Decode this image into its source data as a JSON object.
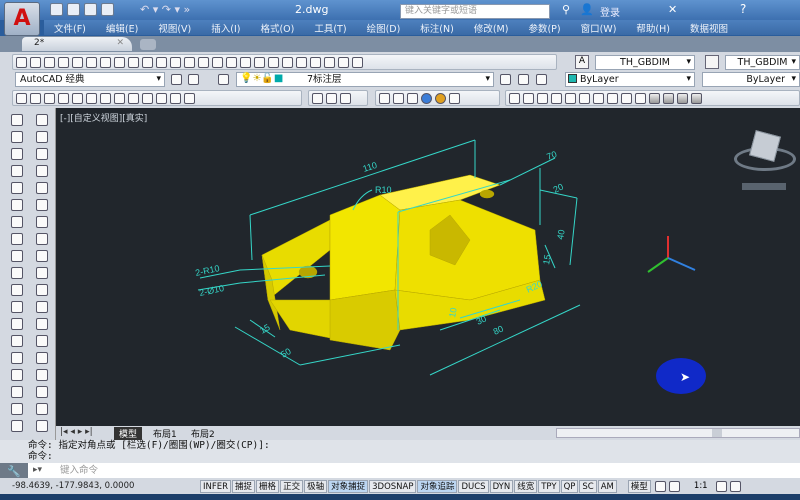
{
  "title": {
    "doc": "2.dwg",
    "search_placeholder": "键入关键字或短语",
    "login": "登录"
  },
  "menu": [
    "文件(F)",
    "编辑(E)",
    "视图(V)",
    "插入(I)",
    "格式(O)",
    "工具(T)",
    "绘图(D)",
    "标注(N)",
    "修改(M)",
    "参数(P)",
    "窗口(W)",
    "帮助(H)",
    "数据视图"
  ],
  "doc_tab": "2*",
  "toolbar": {
    "dimstyle1": "TH_GBDIM",
    "dimstyle2": "TH_GBDIM",
    "workspace": "AutoCAD 经典",
    "layer": "7标注层",
    "color": "ByLayer",
    "linetype": "ByLayer"
  },
  "viewport": {
    "label": "[-][自定义视图][真实]"
  },
  "drawing": {
    "dims": [
      "110",
      "70",
      "R10",
      "20",
      "40",
      "15",
      "R20",
      "10",
      "30",
      "80",
      "15",
      "50",
      "2-R10",
      "2-Ø10"
    ]
  },
  "layout_tabs": [
    "模型",
    "布局1",
    "布局2"
  ],
  "command": {
    "line1": "命令: 指定对角点或 [栏选(F)/圈围(WP)/圈交(CP)]:",
    "line2": "命令:",
    "placeholder": "键入命令"
  },
  "status": {
    "coords": "-98.4639,  -177.9843, 0.0000",
    "toggles": [
      {
        "label": "INFER",
        "on": false
      },
      {
        "label": "捕捉",
        "on": false
      },
      {
        "label": "栅格",
        "on": false
      },
      {
        "label": "正交",
        "on": false
      },
      {
        "label": "极轴",
        "on": false
      },
      {
        "label": "对象捕捉",
        "on": true
      },
      {
        "label": "3DOSNAP",
        "on": false
      },
      {
        "label": "对象追踪",
        "on": true
      },
      {
        "label": "DUCS",
        "on": false
      },
      {
        "label": "DYN",
        "on": false
      },
      {
        "label": "线宽",
        "on": false
      },
      {
        "label": "TPY",
        "on": false
      },
      {
        "label": "QP",
        "on": false
      },
      {
        "label": "SC",
        "on": false
      },
      {
        "label": "AM",
        "on": false
      }
    ],
    "model": "模型",
    "scale": "1:1"
  },
  "colors": {
    "part": "#f2e600",
    "dim": "#35d6c8",
    "viewport_bg": "#21262c"
  }
}
